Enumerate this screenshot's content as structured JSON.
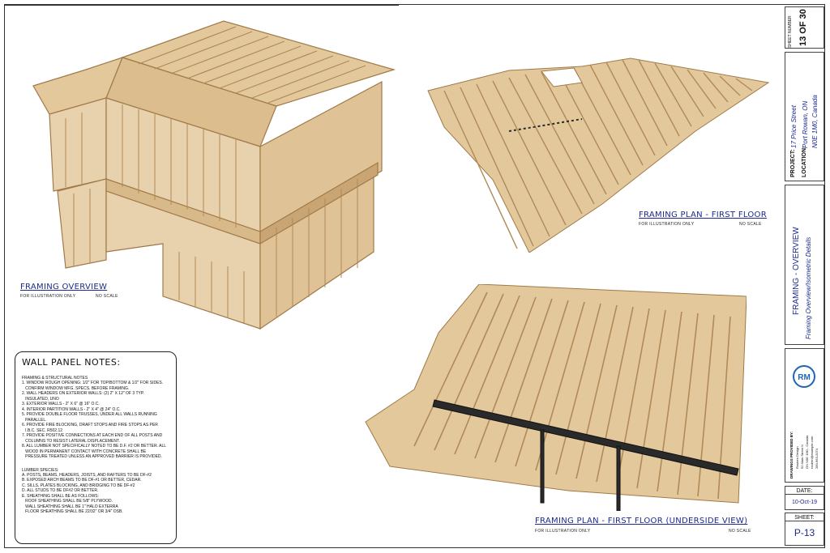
{
  "views": {
    "overview": {
      "title": "FRAMING OVERVIEW",
      "note": "FOR ILLUSTRATION ONLY",
      "scale": "NO SCALE"
    },
    "plan": {
      "title": "FRAMING PLAN - FIRST FLOOR",
      "note": "FOR ILLUSTRATION ONLY",
      "scale": "NO SCALE"
    },
    "underside": {
      "title": "FRAMING PLAN - FIRST FLOOR (UNDERSIDE VIEW)",
      "note": "FOR ILLUSTRATION ONLY",
      "scale": "NO SCALE"
    }
  },
  "notes": {
    "heading": "WALL PANEL NOTES:",
    "framing_title": "FRAMING & STRUCTURAL NOTES",
    "framing_items": [
      "1. WINDOW ROUGH OPENING: 1/2\" FOR TOP/BOTTOM & 1/2\" FOR SIDES.\n   CONFIRM WINDOW MFG. SPECS. BEFORE FRAMING.",
      "2. WALL HEADERS ON EXTERIOR WALLS: (2) 2\" X 12\" OF 3 TYP.\n   INSULATED, UNO",
      "3. EXTERIOR WALLS - 2\" X 6\" @ 16\" O.C.",
      "4. INTERIOR PARTITION WALLS - 2\" X 4\" @ 24\" O.C.",
      "5. PROVIDE DOUBLE FLOOR TRUSSES, UNDER ALL WALLS RUNNING\n   PARALLEL.",
      "6. PROVIDE FIRE BLOCKING, DRAFT STOPS AND FIRE STOPS AS PER\n   I.B.C. SEC. R502.12",
      "7. PROVIDE POSITIVE CONNECTIONS AT EACH END OF ALL POSTS AND\n   COLUMNS TO RESIST LATERAL DISPLACEMENT.",
      "8. ALL LUMBER NOT SPECIFICALLY NOTED TO BE D.F. #2 OR BETTER. ALL\n   WOOD IN PERMANENT CONTACT WITH CONCRETE SHALL BE\n   PRESSURE TREATED UNLESS AN APPROVED BARRIER IS PROVIDED."
    ],
    "lumber_title": "LUMBER SPECIES:",
    "lumber_items": [
      "A. POSTS, BEAMS, HEADERS, JOISTS, AND RAFTERS TO BE DF-#2",
      "B. EXPOSED ARCH BEAMS TO BE DF-#1 OR BETTER, CEDAR.",
      "C. SILLS, PLATES BLOCKING, AND BRIDGING TO BE DF-#2",
      "D. ALL STUDS TO BE DF#2 OR BETTER.",
      "E. SHEATHING SHALL BE AS FOLLOWS:\n   ROOF SHEATHING SHALL BE 5/8\" PLYWOOD.\n   WALL SHEATHING SHALL BE 1\" HALO EXTERRA\n   FLOOR SHEATHING SHALL BE 22/32\" OR 3/4\" OSB."
    ]
  },
  "title_block": {
    "sheet_number_label": "SHEET NUMBER",
    "sheet_number": "13 OF 30",
    "project_label": "PROJECT:",
    "project": "17 Price Street",
    "location_label": "LOCATION:",
    "location_line1": "Port Rowan, ON",
    "location_line2": "N0E 1M0, Canada",
    "sheet_title": "FRAMING - OVERVIEW",
    "sheet_subtitle": "Framing Overview/Isometric Details",
    "drawings_by_label": "DRAWINGS PROVIDED BY:",
    "company_lines": [
      "Rouben Design",
      "52 Main Street N",
      "ON N0E 1M0 - Canada",
      "rouben@example.com",
      "289-663-2074"
    ],
    "logo_text": "RM",
    "date_label": "DATE:",
    "date": "10-Oct-19",
    "sheet_label": "SHEET:",
    "sheet": "P-13"
  },
  "colors": {
    "wood": "#d8b98a",
    "wood_dark": "#b08a58",
    "steel": "#2a2a2a",
    "title_blue": "#1b2a8c",
    "logo_blue": "#1f64b5"
  }
}
